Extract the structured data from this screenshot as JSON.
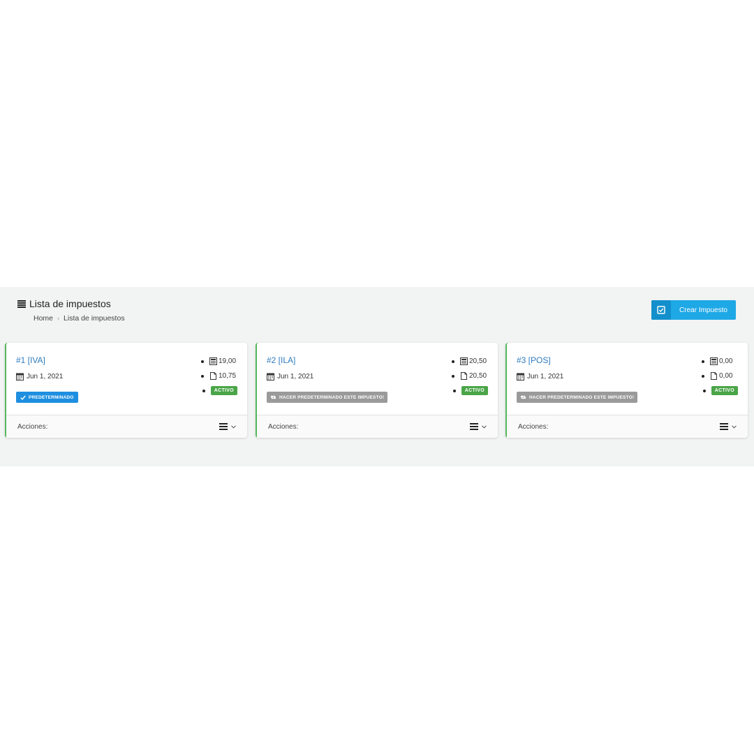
{
  "header": {
    "title": "Lista de impuestos",
    "title_icon": "list-icon",
    "breadcrumb": {
      "home": "Home",
      "separator": "›",
      "current": "Lista de impuestos"
    },
    "create_button": {
      "label": "Crear Impuesto",
      "icon": "check-square-icon"
    }
  },
  "cards": [
    {
      "title": "#1 [IVA]",
      "date": "Jun 1, 2021",
      "stat_1": "19,00",
      "stat_2": "10,75",
      "status": "ACTIVO",
      "default_badge": "PREDETERMINADO",
      "footer_label": "Acciones:"
    },
    {
      "title": "#2 [ILA]",
      "date": "Jun 1, 2021",
      "stat_1": "20,50",
      "stat_2": "20,50",
      "status": "ACTIVO",
      "make_default": "HACER PREDETERMINADO ESTE IMPUESTO!",
      "footer_label": "Acciones:"
    },
    {
      "title": "#3 [POS]",
      "date": "Jun 1, 2021",
      "stat_1": "0,00",
      "stat_2": "0,00",
      "status": "ACTIVO",
      "make_default": "HACER PREDETERMINADO ESTE IMPUESTO!",
      "footer_label": "Acciones:"
    }
  ],
  "colors": {
    "accent": "#1ea8e6",
    "card_border": "#55b85e",
    "active_badge": "#4aa548",
    "default_badge": "#1e8fe0",
    "link": "#2e7bbf"
  }
}
